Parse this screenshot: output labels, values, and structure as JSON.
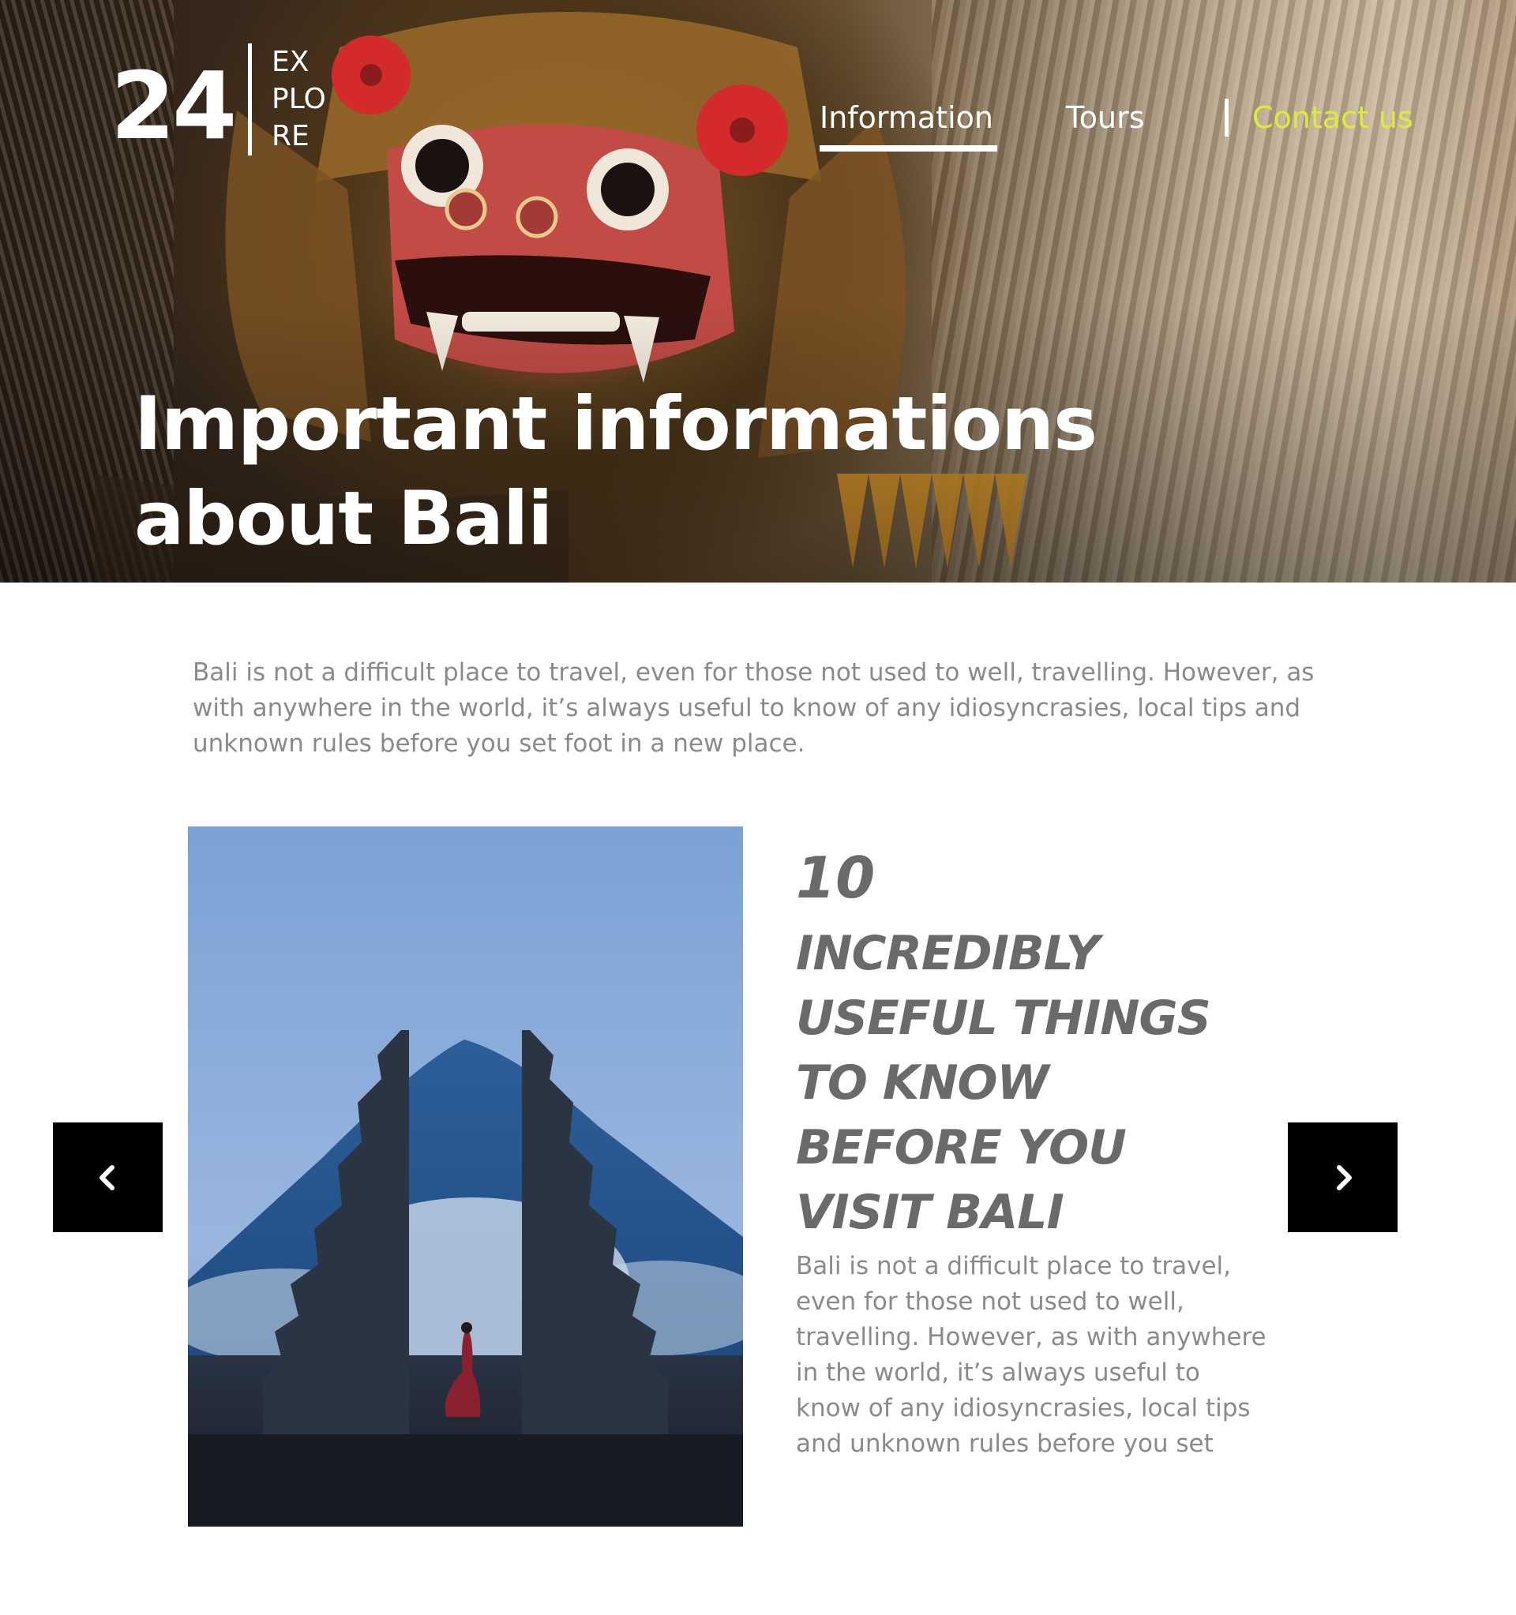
{
  "logo": {
    "number": "24",
    "word_lines": [
      "EX",
      "PLO",
      "RE"
    ]
  },
  "nav": {
    "items": [
      {
        "label": "Information",
        "active": true
      },
      {
        "label": "Tours",
        "active": false
      },
      {
        "label": "Contact us",
        "active": false
      }
    ],
    "contact_color": "#d8ee3a"
  },
  "hero": {
    "title_lines": [
      "Important informations",
      "about Bali"
    ]
  },
  "intro": {
    "text": "Bali is not a difficult place to travel, even for those not used to well, travelling. However, as with anywhere in the world, it’s always useful to know of any idiosyncrasies, local tips and unknown rules before you set foot in a new place."
  },
  "feature": {
    "number": "10",
    "title_lines": [
      "INCREDIBLY",
      "USEFUL THINGS",
      "TO KNOW",
      "BEFORE YOU",
      "VISIT BALI"
    ],
    "text": "Bali is not a difficult place to travel, even for those not used to well, travelling. However, as with anywhere in the world, it’s always useful to know of any idiosyncrasies, local tips and unknown rules before you set"
  },
  "carousel": {
    "prev_icon": "chevron-left-icon",
    "next_icon": "chevron-right-icon"
  },
  "colors": {
    "heading_gray": "#6a6a6a",
    "body_gray": "#8a8a8a",
    "arrow_bg": "#000000",
    "accent": "#d8ee3a"
  }
}
